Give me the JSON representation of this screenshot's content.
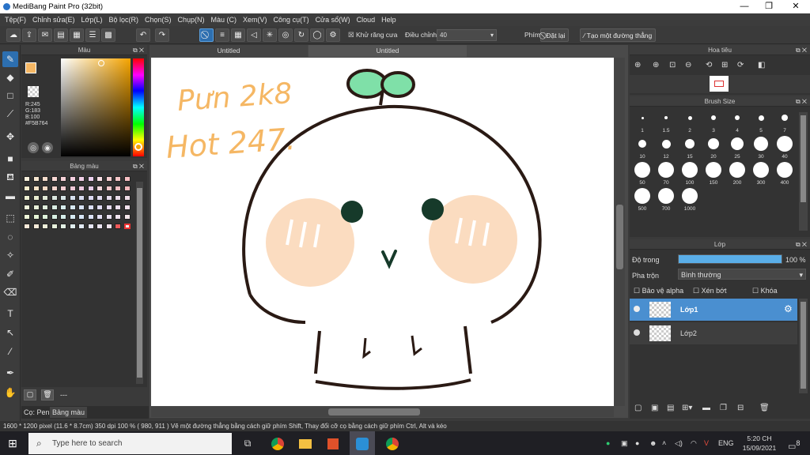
{
  "window": {
    "title": "MediBang Paint Pro (32bit)",
    "min": "—",
    "max": "❐",
    "close": "✕"
  },
  "menu": [
    "Tệp(F)",
    "Chỉnh sửa(E)",
    "Lớp(L)",
    "Bộ lọc(R)",
    "Chọn(S)",
    "Chụp(N)",
    "Màu (C)",
    "Xem(V)",
    "Công cụ(T)",
    "Cửa sổ(W)",
    "Cloud",
    "Help"
  ],
  "toolbar": {
    "antialias_label": "Khử răng cưa",
    "adjust_label": "Điều chỉnh",
    "adjust_value": "40",
    "key_label": "Phím",
    "reset_label": "Đặt lại",
    "straight_line_label": "Tạo một đường thẳng"
  },
  "color_panel": {
    "title": "Màu",
    "r": "R:245",
    "g": "G:183",
    "b": "B:100",
    "hex": "#F5B764",
    "fg_color": "#F5B764"
  },
  "palette_panel": {
    "title": "Bảng màu",
    "footer_text": "---",
    "colors": [
      "#f8f0dc",
      "#f6e6d0",
      "#f4dccc",
      "#f8d8d4",
      "#f6d2d8",
      "#f4cfe0",
      "#f0d0e8",
      "#ecd2f0",
      "#f8e0e6",
      "#f6d0d2",
      "#f4c6c8",
      "#f8c0c4",
      "#f6eccc",
      "#f4e2c6",
      "#f2d8c4",
      "#f4d4cc",
      "#f2ccd2",
      "#f0c8d8",
      "#ecc8e0",
      "#e6cce8",
      "#f4d8de",
      "#f2c8cc",
      "#f0bec2",
      "#f4b8bc",
      "#eef0d2",
      "#e8ecd0",
      "#e0e8d6",
      "#dae6de",
      "#d6e4e6",
      "#d6e0ee",
      "#d8dcf2",
      "#dcdaf4",
      "#e2dcf2",
      "#e6dcee",
      "#eadcea",
      "#eedce6",
      "#f0f4dc",
      "#e8f0d8",
      "#e0eedc",
      "#daeee4",
      "#d6ecec",
      "#d6e8f2",
      "#d8e4f6",
      "#dce0f8",
      "#e2def8",
      "#e8def4",
      "#eee0f0",
      "#f2e2ec",
      "#eef6d8",
      "#e6f4d6",
      "#def2da",
      "#d8f0e2",
      "#d6eeea",
      "#d6eaf2",
      "#d8e6f6",
      "#dce2f8",
      "#e4e0f6",
      "#eae2f2",
      "#f0e4ee",
      "#f4e6ea",
      "#f8e8d8",
      "#f4ead8",
      "#eceed8",
      "#e6f0dc",
      "#e2f0e4",
      "#e0eeee",
      "#e2eaf4",
      "#e6e6f6",
      "#ece6f4",
      "#f2e6f0",
      "#ef5a5a",
      "#f0f0f0"
    ]
  },
  "tabs": {
    "pen": "Cọ: Pen",
    "palette": "Bảng màu"
  },
  "document": {
    "tab1": "Untitled",
    "tab2": "Untitled"
  },
  "canvas": {
    "handwriting1": "Pưn 2k8",
    "handwriting2": "Hot 247."
  },
  "navigator": {
    "title": "Hoa tiêu"
  },
  "brush_size": {
    "title": "Brush Size",
    "sizes": [
      "1",
      "1.5",
      "2",
      "3",
      "4",
      "5",
      "7",
      "10",
      "12",
      "15",
      "20",
      "25",
      "30",
      "40",
      "50",
      "70",
      "100",
      "150",
      "200",
      "300",
      "400",
      "500",
      "700",
      "1000"
    ]
  },
  "layer_panel": {
    "title": "Lớp",
    "opacity_label": "Độ trong",
    "opacity_value": "100 %",
    "opacity_fraction": 1.0,
    "blend_label": "Pha trộn",
    "blend_value": "Bình thường",
    "protect_alpha": "Bảo vệ alpha",
    "clipping": "Xén bớt",
    "lock": "Khóa",
    "layers": [
      {
        "name": "Lớp1",
        "selected": true
      },
      {
        "name": "Lớp2",
        "selected": false
      }
    ]
  },
  "status": {
    "size": "1600 * 1200 pixel",
    "cm": "(11.6 * 8.7cm)",
    "dpi": "350 dpi",
    "zoom": "100 %",
    "coords": "( 980, 911 )",
    "hint": "Vẽ một đường thẳng bằng cách giữ phím Shift, Thay đổi cỡ cọ bằng cách giữ phím Ctrl, Alt và kéo"
  },
  "taskbar": {
    "search_placeholder": "Type here to search",
    "lang": "ENG",
    "time": "5:20 CH",
    "date": "15/09/2021",
    "notif_count": "8"
  },
  "colors": {
    "accent": "#2d6fb0",
    "skull_cheek": "#fbdcc0",
    "sprout": "#7fe0a8",
    "text_orange": "#f5b764"
  }
}
